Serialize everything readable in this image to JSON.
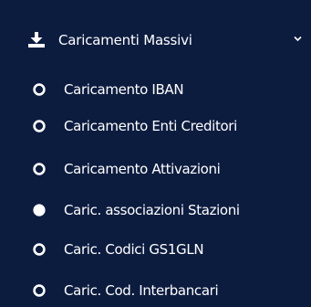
{
  "menu": {
    "header": {
      "label": "Caricamenti Massivi",
      "icon": "download-icon",
      "expanded": true
    },
    "items": [
      {
        "label": "Caricamento IBAN",
        "icon": "circle-outline-icon",
        "active": false
      },
      {
        "label": "Caricamento Enti Creditori",
        "icon": "circle-outline-icon",
        "active": false
      },
      {
        "label": "Caricamento Attivazioni",
        "icon": "circle-outline-icon",
        "active": false
      },
      {
        "label": "Caric. associazioni Stazioni",
        "icon": "circle-filled-icon",
        "active": true
      },
      {
        "label": "Caric. Codici GS1GLN",
        "icon": "circle-outline-icon",
        "active": false
      },
      {
        "label": "Caric. Cod. Interbancari",
        "icon": "circle-outline-icon",
        "active": false
      }
    ],
    "colors": {
      "background": "#0c1c3f",
      "text": "#ffffff"
    }
  }
}
